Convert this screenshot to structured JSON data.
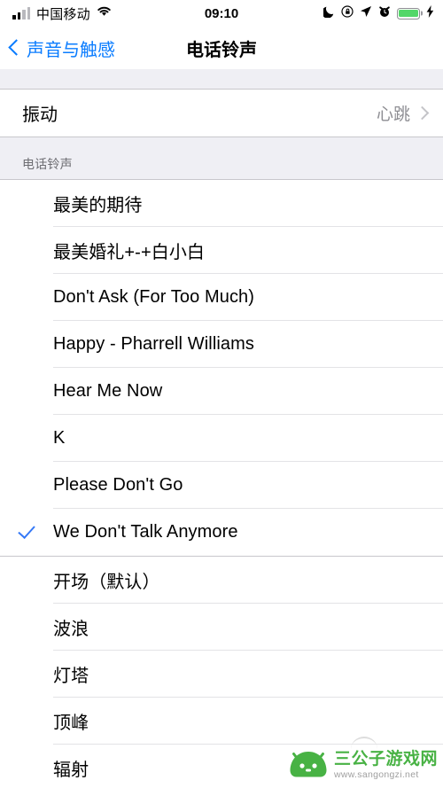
{
  "status_bar": {
    "carrier": "中国移动",
    "time": "09:10",
    "signal_icon": "signal-bars-icon",
    "wifi_icon": "wifi-icon",
    "dnd_icon": "moon-icon",
    "rotation_lock_icon": "rotation-lock-icon",
    "location_icon": "location-arrow-icon",
    "alarm_icon": "alarm-clock-icon",
    "battery_icon": "battery-icon",
    "charging_icon": "lightning-bolt-icon",
    "battery_color": "#53d769"
  },
  "nav": {
    "back_label": "声音与触感",
    "title": "电话铃声",
    "accent_color": "#0a7cff"
  },
  "vibration": {
    "label": "振动",
    "value": "心跳"
  },
  "section": {
    "header": "电话铃声"
  },
  "custom_ringtones": [
    {
      "label": "最美的期待",
      "selected": false
    },
    {
      "label": "最美婚礼+-+白小白",
      "selected": false
    },
    {
      "label": "Don't Ask (For Too Much)",
      "selected": false
    },
    {
      "label": "Happy - Pharrell Williams",
      "selected": false
    },
    {
      "label": "Hear Me Now",
      "selected": false
    },
    {
      "label": "K",
      "selected": false
    },
    {
      "label": "Please Don't Go",
      "selected": false
    },
    {
      "label": "We Don't Talk Anymore",
      "selected": true
    }
  ],
  "system_ringtones": [
    {
      "label": "开场（默认）",
      "selected": false
    },
    {
      "label": "波浪",
      "selected": false
    },
    {
      "label": "灯塔",
      "selected": false
    },
    {
      "label": "顶峰",
      "selected": false
    },
    {
      "label": "辐射",
      "selected": false
    }
  ],
  "selection": {
    "checkmark_color": "#3478f6",
    "checkmark_icon": "checkmark-icon"
  },
  "watermark": {
    "name": "三公子游戏网",
    "url": "www.sangongzi.net",
    "color": "#3fae3b"
  }
}
